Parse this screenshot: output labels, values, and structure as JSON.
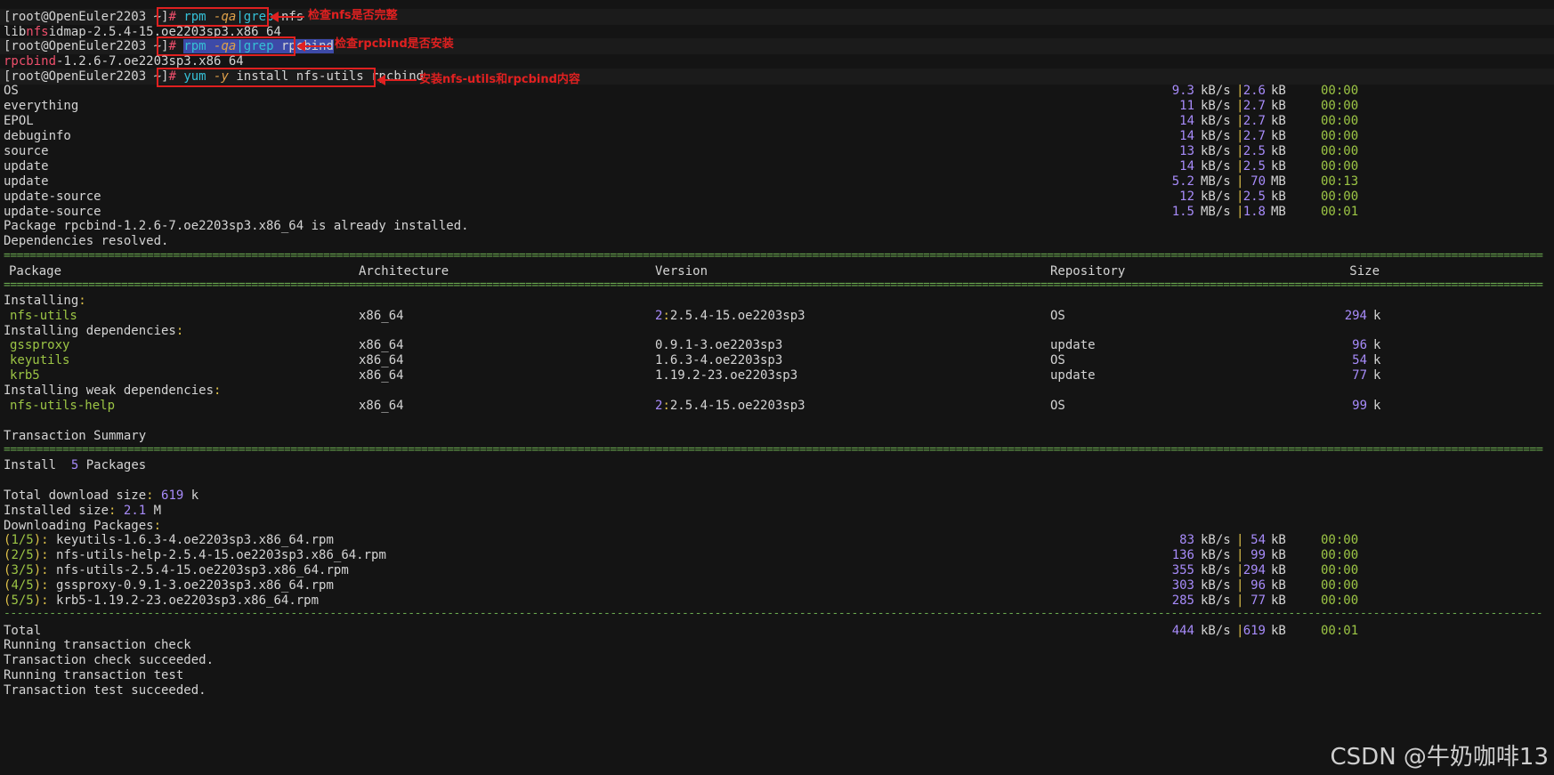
{
  "prompt": "[root@OpenEuler2203 ~]",
  "hash": "#",
  "cmd1": {
    "a": "rpm",
    "b": "-qa",
    "c": "|",
    "d": "grep",
    "e": "nfs"
  },
  "out1": {
    "pre": "lib",
    "hl": "nfs",
    "post": "idmap-2.5.4-15.oe2203sp3.x86_64"
  },
  "cmd2": {
    "a": "rpm",
    "b": "-qa",
    "c": "|",
    "d": "grep",
    "e": "rpcbind"
  },
  "out2": {
    "hl": "rpcbind",
    "post": "-1.2.6-7.oe2203sp3.x86_64"
  },
  "cmd3": {
    "a": "yum",
    "b": "-y",
    "c": "install nfs-utils rpcbind"
  },
  "annotations": [
    "检查nfs是否完整",
    "检查rpcbind是否安装",
    "安装nfs-utils和rpcbind内容"
  ],
  "repos": [
    {
      "name": "OS",
      "speed": "9.3",
      "su": "kB/s",
      "size": "2.6",
      "zu": "kB",
      "time": "00:00"
    },
    {
      "name": "everything",
      "speed": "11",
      "su": "kB/s",
      "size": "2.7",
      "zu": "kB",
      "time": "00:00"
    },
    {
      "name": "EPOL",
      "speed": "14",
      "su": "kB/s",
      "size": "2.7",
      "zu": "kB",
      "time": "00:00"
    },
    {
      "name": "debuginfo",
      "speed": "14",
      "su": "kB/s",
      "size": "2.7",
      "zu": "kB",
      "time": "00:00"
    },
    {
      "name": "source",
      "speed": "13",
      "su": "kB/s",
      "size": "2.5",
      "zu": "kB",
      "time": "00:00"
    },
    {
      "name": "update",
      "speed": "14",
      "su": "kB/s",
      "size": "2.5",
      "zu": "kB",
      "time": "00:00"
    },
    {
      "name": "update",
      "speed": "5.2",
      "su": "MB/s",
      "size": "70",
      "zu": "MB",
      "time": "00:13"
    },
    {
      "name": "update-source",
      "speed": "12",
      "su": "kB/s",
      "size": "2.5",
      "zu": "kB",
      "time": "00:00"
    },
    {
      "name": "update-source",
      "speed": "1.5",
      "su": "MB/s",
      "size": "1.8",
      "zu": "MB",
      "time": "00:01"
    }
  ],
  "msg_installed": "Package rpcbind-1.2.6-7.oe2203sp3.x86_64 is already installed.",
  "msg_resolved": "Dependencies resolved.",
  "headers": {
    "package": "Package",
    "arch": "Architecture",
    "version": "Version",
    "repo": "Repository",
    "size": "Size"
  },
  "sections": {
    "installing": "Installing",
    "deps": "Installing dependencies",
    "weak": "Installing weak dependencies"
  },
  "packages": [
    {
      "name": "nfs-utils",
      "arch": "x86_64",
      "epoch": "2",
      "ver": "2.5.4-15.oe2203sp3",
      "repo": "OS",
      "size": "294",
      "unit": "k"
    },
    {
      "name": "gssproxy",
      "arch": "x86_64",
      "epoch": "",
      "ver": "0.9.1-3.oe2203sp3",
      "repo": "update",
      "size": "96",
      "unit": "k"
    },
    {
      "name": "keyutils",
      "arch": "x86_64",
      "epoch": "",
      "ver": "1.6.3-4.oe2203sp3",
      "repo": "OS",
      "size": "54",
      "unit": "k"
    },
    {
      "name": "krb5",
      "arch": "x86_64",
      "epoch": "",
      "ver": "1.19.2-23.oe2203sp3",
      "repo": "update",
      "size": "77",
      "unit": "k"
    },
    {
      "name": "nfs-utils-help",
      "arch": "x86_64",
      "epoch": "2",
      "ver": "2.5.4-15.oe2203sp3",
      "repo": "OS",
      "size": "99",
      "unit": "k"
    }
  ],
  "summary_title": "Transaction Summary",
  "install_line": {
    "label": "Install",
    "count": "5",
    "unit": "Packages"
  },
  "total_download": {
    "label": "Total download size",
    "value": "619",
    "unit": "k"
  },
  "installed_size": {
    "label": "Installed size",
    "value": "2.1",
    "unit": "M"
  },
  "downloading": "Downloading Packages",
  "downloads": [
    {
      "idx": "1/5",
      "file": "keyutils-1.6.3-4.oe2203sp3.x86_64.rpm",
      "speed": "83",
      "size": "54",
      "time": "00:00"
    },
    {
      "idx": "2/5",
      "file": "nfs-utils-help-2.5.4-15.oe2203sp3.x86_64.rpm",
      "speed": "136",
      "size": "99",
      "time": "00:00"
    },
    {
      "idx": "3/5",
      "file": "nfs-utils-2.5.4-15.oe2203sp3.x86_64.rpm",
      "speed": "355",
      "size": "294",
      "time": "00:00"
    },
    {
      "idx": "4/5",
      "file": "gssproxy-0.9.1-3.oe2203sp3.x86_64.rpm",
      "speed": "303",
      "size": "96",
      "time": "00:00"
    },
    {
      "idx": "5/5",
      "file": "krb5-1.19.2-23.oe2203sp3.x86_64.rpm",
      "speed": "285",
      "size": "77",
      "time": "00:00"
    }
  ],
  "dl_units": {
    "speed": "kB/s",
    "size": "kB"
  },
  "total": {
    "label": "Total",
    "speed": "444",
    "su": "kB/s",
    "size": "619",
    "zu": "kB",
    "time": "00:01"
  },
  "tail": [
    "Running transaction check",
    "Transaction check succeeded.",
    "Running transaction test",
    "Transaction test succeeded."
  ],
  "watermark": "CSDN @牛奶咖啡13"
}
